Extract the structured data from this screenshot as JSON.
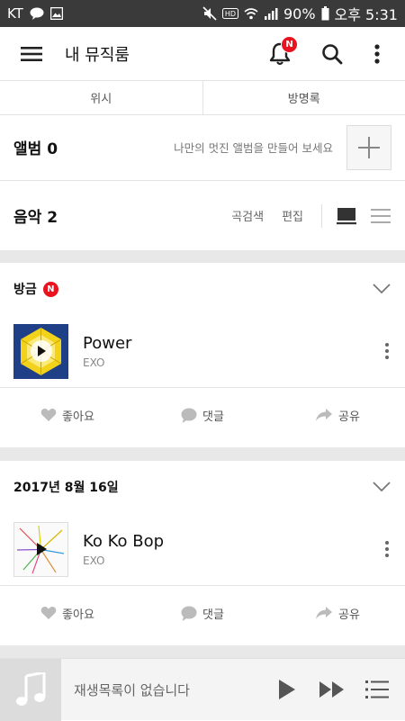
{
  "statusbar": {
    "carrier": "KT",
    "battery": "90%",
    "time": "오후 5:31"
  },
  "header": {
    "title": "내 뮤직룸",
    "notification_badge": "N"
  },
  "tabs": [
    {
      "label": "위시"
    },
    {
      "label": "방명록"
    }
  ],
  "album_section": {
    "title": "앨범 0",
    "hint": "나만의 멋진 앨범을 만들어 보세요"
  },
  "music_section": {
    "title": "음악 2",
    "search_label": "곡검색",
    "edit_label": "편집"
  },
  "feed": [
    {
      "heading": "방금",
      "new_badge": "N",
      "track": {
        "title": "Power",
        "artist": "EXO"
      },
      "actions": {
        "like": "좋아요",
        "comment": "댓글",
        "share": "공유"
      }
    },
    {
      "heading": "2017년 8월 16일",
      "track": {
        "title": "Ko Ko Bop",
        "artist": "EXO"
      },
      "actions": {
        "like": "좋아요",
        "comment": "댓글",
        "share": "공유"
      }
    }
  ],
  "player": {
    "empty_text": "재생목록이 없습니다"
  },
  "colors": {
    "accent_red": "#e8131f",
    "statusbar_bg": "#3a3a3a",
    "divider": "#e8e8e8"
  }
}
